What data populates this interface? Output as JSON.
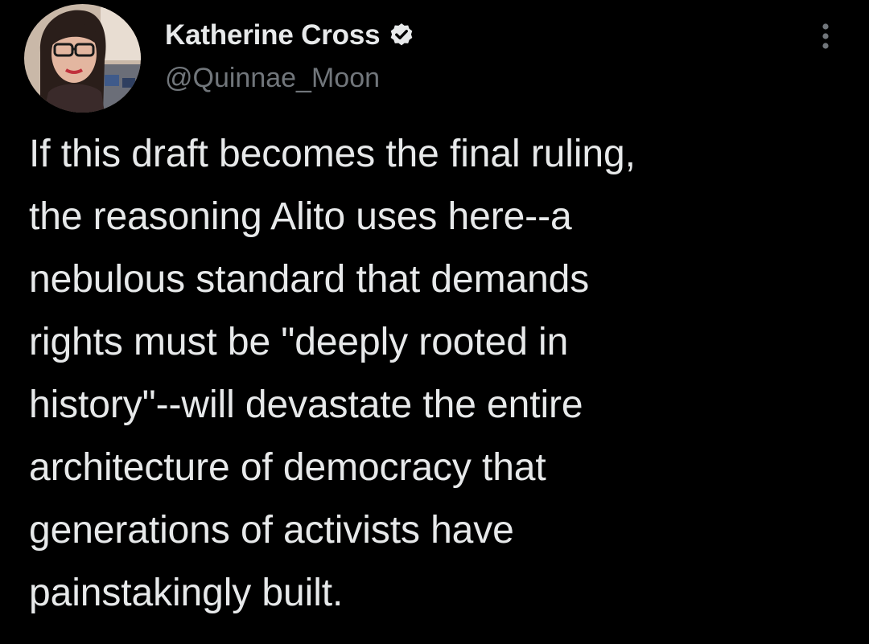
{
  "tweet": {
    "author": {
      "display_name": "Katherine Cross",
      "handle": "@Quinnae_Moon",
      "verified": true,
      "avatar_icon": "profile-photo-avatar"
    },
    "more_icon": "vertical-ellipsis-icon",
    "text_lines": [
      "If this draft becomes the final ruling,",
      "the reasoning Alito uses here--a",
      "nebulous standard that demands",
      "rights must be \"deeply rooted in",
      "history\"--will devastate the entire",
      "architecture of democracy that",
      "generations of activists have",
      "painstakingly built."
    ]
  },
  "colors": {
    "background": "#000000",
    "primary_text": "#e7e9ea",
    "secondary_text": "#71767b",
    "verified_badge": "#e7e9ea"
  }
}
